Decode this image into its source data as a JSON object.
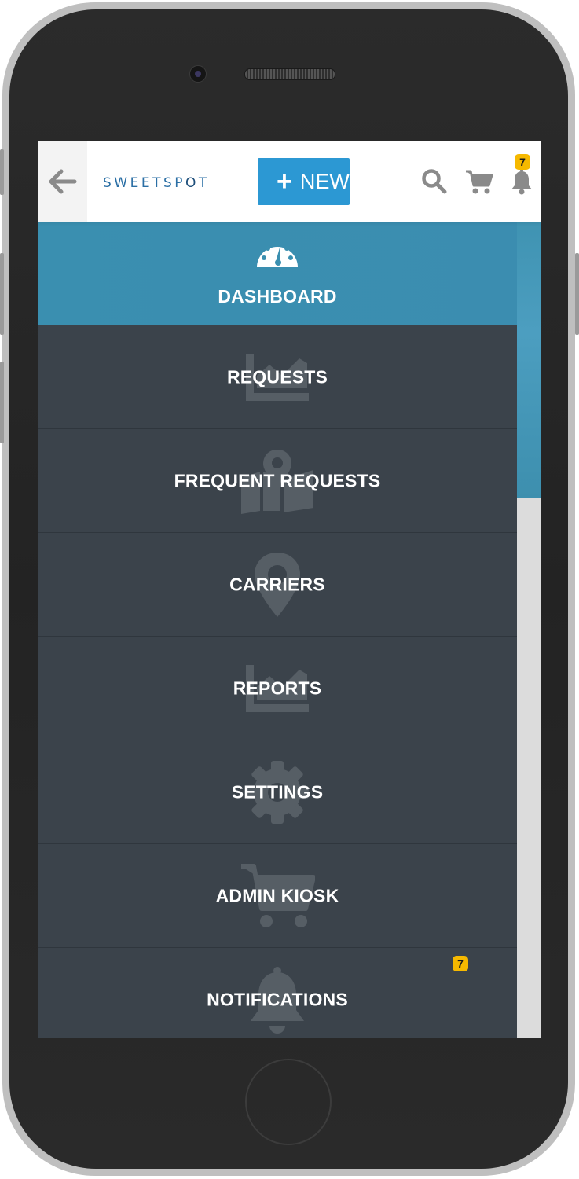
{
  "header": {
    "logo_text_a": "SWEETSP",
    "logo_text_b": "O",
    "logo_text_c": "T",
    "new_button_label": "NEW",
    "notification_count": "7"
  },
  "menu": {
    "items": [
      {
        "label": "DASHBOARD",
        "icon": "dashboard-icon"
      },
      {
        "label": "REQUESTS",
        "icon": "chart-icon"
      },
      {
        "label": "FREQUENT REQUESTS",
        "icon": "map-icon"
      },
      {
        "label": "CARRIERS",
        "icon": "map-marker-icon"
      },
      {
        "label": "REPORTS",
        "icon": "chart-icon"
      },
      {
        "label": "SETTINGS",
        "icon": "gear-icon"
      },
      {
        "label": "ADMIN KIOSK",
        "icon": "cart-icon"
      },
      {
        "label": "NOTIFICATIONS",
        "icon": "bell-icon"
      }
    ],
    "notifications_badge": "7"
  },
  "colors": {
    "accent": "#2c98d3",
    "active_item": "#3a8fb0",
    "menu_bg": "#3b434b",
    "badge": "#f6b900"
  }
}
